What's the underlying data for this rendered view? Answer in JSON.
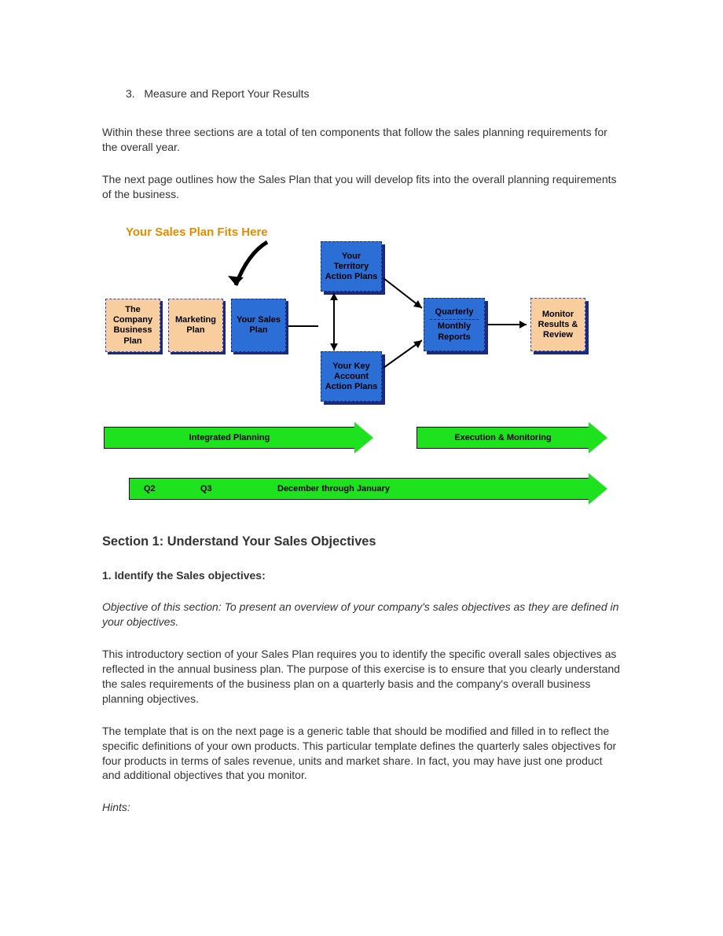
{
  "list": {
    "num": "3.",
    "text": "Measure and Report Your Results"
  },
  "para1": "Within these three sections are a total of ten components that follow the sales planning requirements for the overall year.",
  "para2": "The next page outlines how the Sales Plan that you will develop fits into the overall planning requirements of the business.",
  "diagram": {
    "callout": "Your Sales Plan Fits Here",
    "box_company": "The Company Business Plan",
    "box_marketing": "Marketing Plan",
    "box_sales": "Your Sales Plan",
    "box_territory": "Your Territory Action Plans",
    "box_keyaccount": "Your Key Account Action Plans",
    "box_quarterly_top": "Quarterly",
    "box_quarterly_bot": "Monthly Reports",
    "box_monitor": "Monitor Results & Review",
    "arrow1_label": "Integrated Planning",
    "arrow2_label": "Execution & Monitoring",
    "timeline_q2": "Q2",
    "timeline_q3": "Q3",
    "timeline_dec": "December  through   January"
  },
  "section1_head": "Section 1: Understand Your Sales Objectives",
  "sub1_head": "1. Identify the Sales objectives:",
  "objective_text": "Objective of this section: To present an overview of your company's sales objectives as they are defined in your objectives.",
  "para3": "This introductory section of your Sales Plan requires you to identify the specific overall sales objectives as reflected in the annual business plan. The purpose of this exercise is to ensure that you clearly understand the sales requirements of the business plan on a quarterly basis and the company's overall business planning objectives.",
  "para4": "The template that is on the next page is a generic table that should be modified and filled in to reflect the specific definitions of your own products. This particular template defines the quarterly sales objectives for four products in terms of sales revenue, units and market share. In fact, you may have just one product and additional objectives that you monitor.",
  "hints_label": "Hints:"
}
